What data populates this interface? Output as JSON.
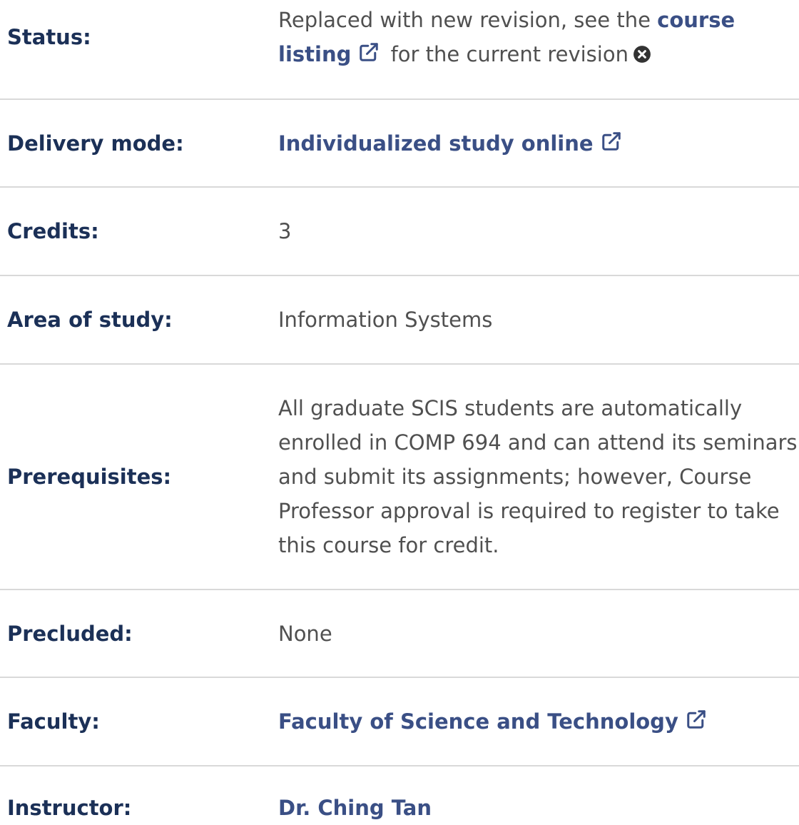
{
  "rows": {
    "status": {
      "label": "Status:",
      "text_before": "Replaced with new revision, see the ",
      "link_text": "course listing",
      "text_after": " for the current revision"
    },
    "delivery": {
      "label": "Delivery mode:",
      "link_text": "Individualized study online"
    },
    "credits": {
      "label": "Credits:",
      "value": "3"
    },
    "area": {
      "label": "Area of study:",
      "value": "Information Systems"
    },
    "prereq": {
      "label": "Prerequisites:",
      "value": "All graduate SCIS students are automatically enrolled in COMP 694 and can attend its seminars and submit its assignments; however, Course Professor approval is required to register to take this course for credit."
    },
    "precluded": {
      "label": "Precluded:",
      "value": "None"
    },
    "faculty": {
      "label": "Faculty:",
      "link_text": "Faculty of Science and Technology"
    },
    "instructor": {
      "label": "Instructor:",
      "link_text": "Dr. Ching Tan"
    }
  },
  "icons": {
    "external_link": "external-link-icon",
    "close": "close-circle-icon"
  },
  "colors": {
    "label": "#1b3057",
    "link": "#3a4f85",
    "text": "#505050",
    "divider": "#d9d9d9"
  }
}
